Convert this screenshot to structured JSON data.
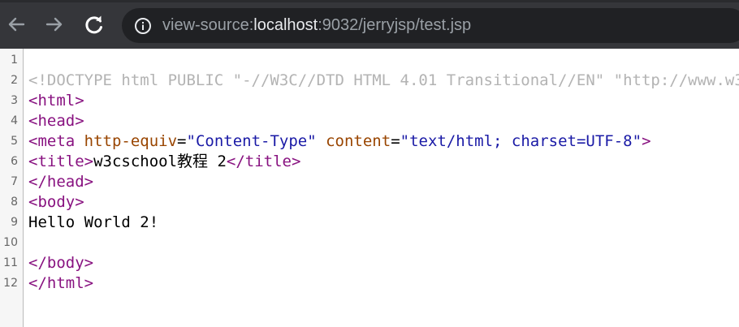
{
  "toolbar": {
    "icons": [
      "back-arrow-icon",
      "forward-arrow-icon",
      "reload-icon",
      "info-icon"
    ],
    "url_scheme": "view-source:",
    "url_host": "localhost",
    "url_port_path": ":9032/jerryjsp/test.jsp"
  },
  "source": {
    "line_numbers": [
      "1",
      "2",
      "3",
      "4",
      "5",
      "6",
      "7",
      "8",
      "9",
      "10",
      "11",
      "12"
    ],
    "l2": "<!DOCTYPE html PUBLIC \"-//W3C//DTD HTML 4.01 Transitional//EN\" \"http://www.w3",
    "l3": "<html>",
    "l4": "<head>",
    "l5_open": "<meta",
    "l5_attr1": "http-equiv",
    "l5_eq1": "=",
    "l5_val1": "\"Content-Type\"",
    "l5_attr2": "content",
    "l5_eq2": "=",
    "l5_val2": "\"text/html; charset=UTF-8\"",
    "l5_close": ">",
    "l6_open": "<title>",
    "l6_text": "w3cschool教程 2",
    "l6_close": "</title>",
    "l7": "</head>",
    "l8": "<body>",
    "l9": "Hello World 2!",
    "l11": "</body>",
    "l12": "</html>"
  },
  "colors": {
    "toolbar_bg": "#35363a",
    "omnibox_bg": "#202124",
    "tag": "#881280",
    "attr": "#994500",
    "value": "#1a1aa6",
    "doctype": "#b3b3b3"
  }
}
